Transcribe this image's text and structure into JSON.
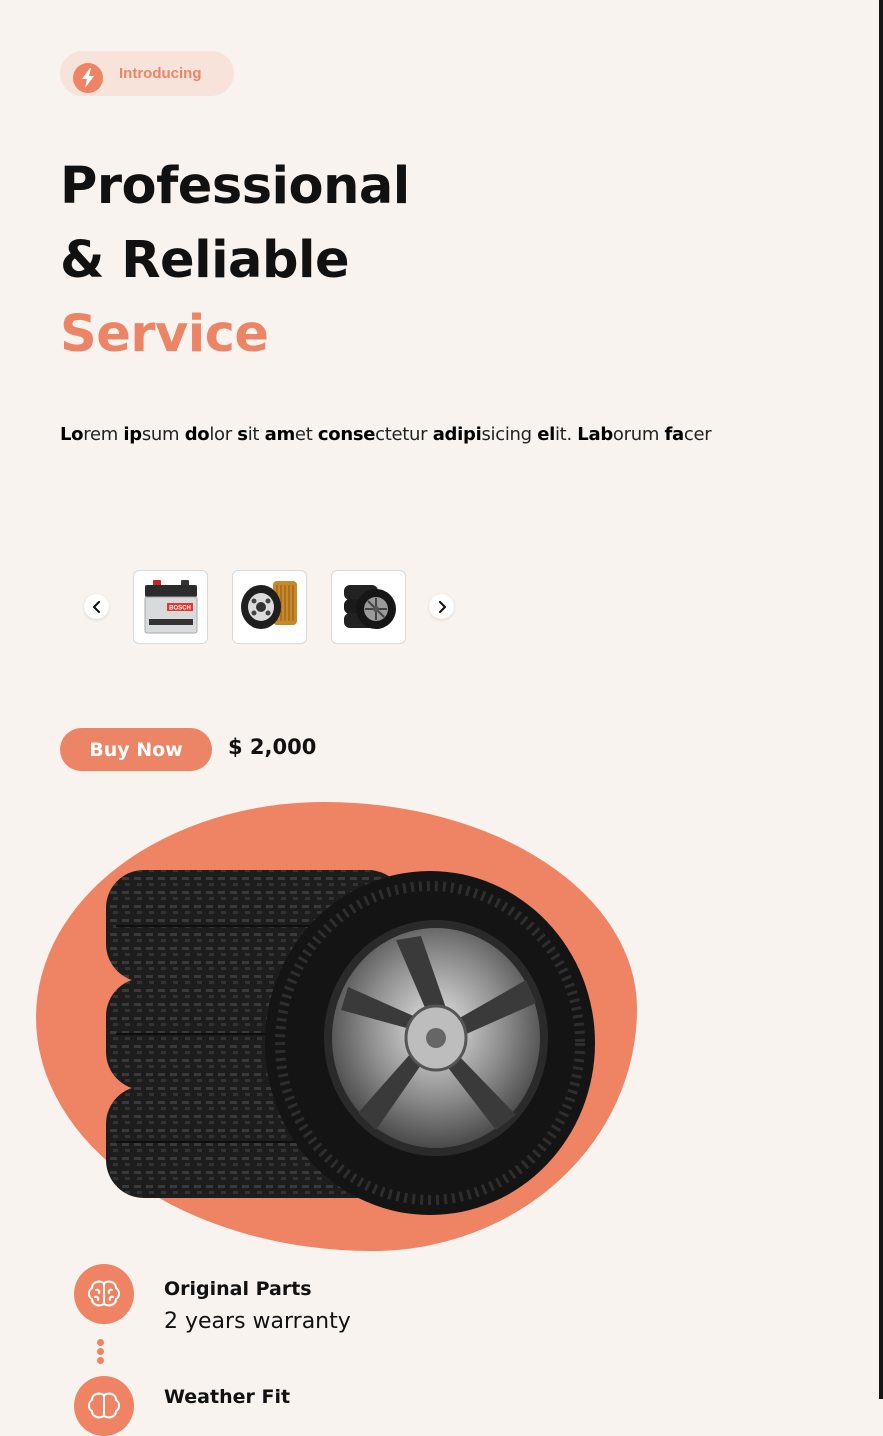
{
  "intro": {
    "label": "Introducing",
    "icon": "lightning-icon"
  },
  "headline": {
    "line1": "Professional",
    "line2": "& Reliable",
    "accent": "Service"
  },
  "description": [
    {
      "b": "Lo",
      "t": "rem "
    },
    {
      "b": "ip",
      "t": "sum "
    },
    {
      "b": "do",
      "t": "lor "
    },
    {
      "b": "s",
      "t": "it "
    },
    {
      "b": "am",
      "t": "et "
    },
    {
      "b": "conse",
      "t": "ctetur "
    },
    {
      "b": "adipi",
      "t": "sicing "
    },
    {
      "b": "el",
      "t": "it. "
    },
    {
      "b": "Lab",
      "t": "orum "
    },
    {
      "b": "fa",
      "t": "cer"
    }
  ],
  "carousel": {
    "prev_icon": "chevron-left-icon",
    "next_icon": "chevron-right-icon",
    "items": [
      {
        "name": "car-battery-thumbnail",
        "brand": "BOSCH"
      },
      {
        "name": "oil-filter-thumbnail"
      },
      {
        "name": "tire-stack-thumbnail"
      }
    ]
  },
  "buy": {
    "label": "Buy Now",
    "price": "$ 2,000"
  },
  "features": [
    {
      "icon": "brain-icon",
      "title": "Original Parts",
      "subtitle": "2 years warranty"
    },
    {
      "icon": "brain-icon",
      "title": "Weather Fit"
    }
  ],
  "colors": {
    "accent": "#ec8565",
    "background": "#f9f3ef",
    "pill_bg": "#f8e3da"
  }
}
